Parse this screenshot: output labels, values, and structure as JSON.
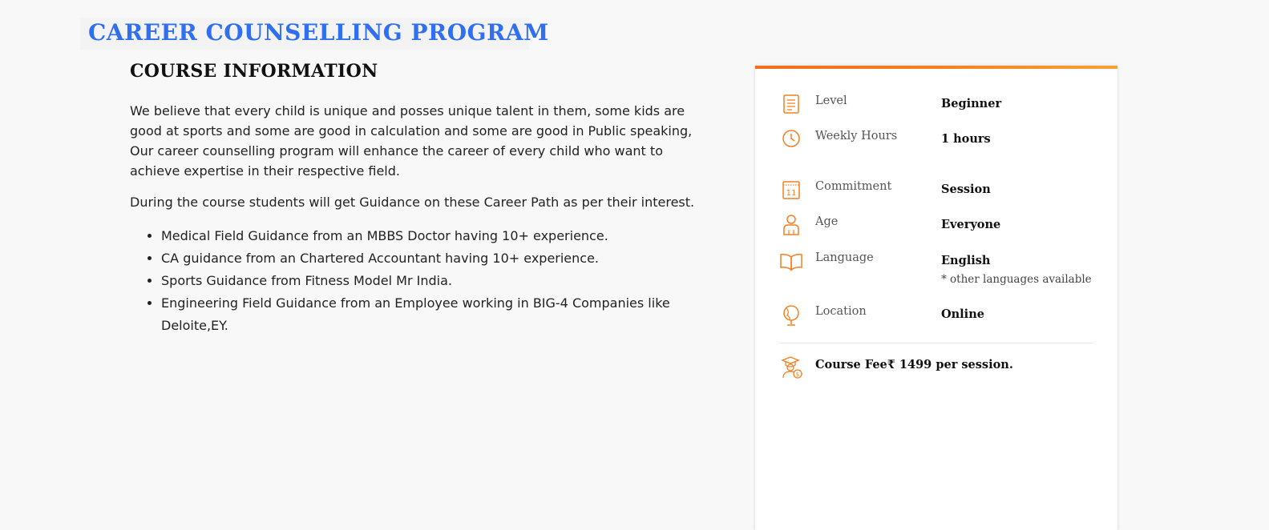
{
  "page_title": "CAREER COUNSELLING PROGRAM",
  "course_info": {
    "heading": "COURSE INFORMATION",
    "paragraph_1": "We believe that every child is unique and posses unique talent in them, some kids are good at sports and some are good in calculation and some are good in Public speaking, Our career counselling program will enhance the career of every child who want to achieve expertise in their respective field.",
    "paragraph_2": "During the course students will get Guidance on these Career Path as per their interest.",
    "guidance_items": [
      "Medical Field Guidance from an MBBS Doctor having 10+ experience.",
      "CA guidance from an Chartered Accountant having 10+ experience.",
      "Sports Guidance from Fitness Model Mr India.",
      "Engineering Field Guidance from an Employee working in BIG-4 Companies like Deloite,EY."
    ]
  },
  "sidebar": {
    "rows": [
      {
        "icon": "document-icon",
        "label": "Level",
        "value": "Beginner"
      },
      {
        "icon": "clock-icon",
        "label": "Weekly Hours",
        "value": "1 hours"
      },
      {
        "icon": "calendar-icon",
        "label": "Commitment",
        "value": "Session",
        "icon_text": "11"
      },
      {
        "icon": "person-icon",
        "label": "Age",
        "value": "Everyone"
      },
      {
        "icon": "book-icon",
        "label": "Language",
        "value": "English",
        "note": "* other languages available"
      },
      {
        "icon": "globe-icon",
        "label": "Location",
        "value": "Online"
      }
    ],
    "fee": {
      "icon": "graduate-fee-icon",
      "text": "Course Fee₹ 1499 per session."
    }
  },
  "colors": {
    "title_blue": "#2f6ff0",
    "accent_orange": "#f57f20",
    "background": "#f8f8f8"
  }
}
